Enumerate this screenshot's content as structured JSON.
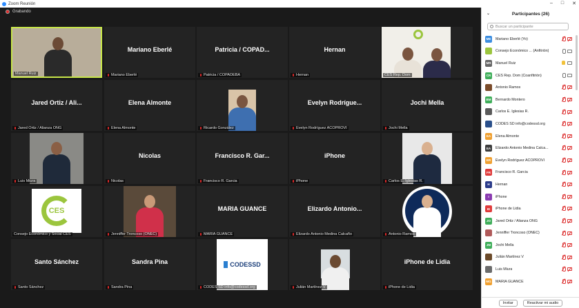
{
  "window": {
    "title": "Zoom Reunión"
  },
  "recording": {
    "label": "Grabando"
  },
  "tiles": [
    {
      "label": "Manuel Ruiz",
      "big": "",
      "muted": false
    },
    {
      "label": "Mariano Eberlé",
      "big": "Mariano Eberlé",
      "muted": true
    },
    {
      "label": "Patricia / COPADEBA",
      "big": "Patricia / COPAD...",
      "muted": true
    },
    {
      "label": "Hernan",
      "big": "Hernan",
      "muted": true
    },
    {
      "label": "CES Rep. Dom",
      "big": "",
      "muted": false
    },
    {
      "label": "Jared Ortiz / Alianza ONG",
      "big": "Jared Ortiz / Ali...",
      "muted": true
    },
    {
      "label": "Elena Almonte",
      "big": "Elena Almonte",
      "muted": true
    },
    {
      "label": "Ricardo González",
      "big": "",
      "muted": true
    },
    {
      "label": "Evelyn Rodríguez ACOPROVI",
      "big": "Evelyn  Rodrígue...",
      "muted": true
    },
    {
      "label": "Jochi Mella",
      "big": "Jochi Mella",
      "muted": true
    },
    {
      "label": "Luis Miura",
      "big": "",
      "muted": true
    },
    {
      "label": "Nicolas",
      "big": "Nicolas",
      "muted": true
    },
    {
      "label": "Francisco  R. Garcia",
      "big": "Francisco  R. Gar...",
      "muted": true
    },
    {
      "label": "iPhone",
      "big": "iPhone",
      "muted": true
    },
    {
      "label": "Carlos E. Iglesias R.",
      "big": "",
      "muted": true
    },
    {
      "label": "Consejo Económico y Social CES",
      "big": "",
      "muted": false
    },
    {
      "label": "Jenniffer Troncoso (ONEC)",
      "big": "",
      "muted": true
    },
    {
      "label": "MARIA GUANCE",
      "big": "MARIA GUANCE",
      "muted": true
    },
    {
      "label": "Elizardo Antonio Medina Calcaño",
      "big": "Elizardo  Antonio...",
      "muted": true
    },
    {
      "label": "Antonio Ramos",
      "big": "",
      "muted": true
    },
    {
      "label": "Santo Sánchez",
      "big": "Santo Sánchez",
      "muted": true
    },
    {
      "label": "Sandra Pina",
      "big": "Sandra Pina",
      "muted": true
    },
    {
      "label": "CODES SD info@codessd.org",
      "big": "",
      "muted": true
    },
    {
      "label": "Julián Martínez V",
      "big": "",
      "muted": true
    },
    {
      "label": "iPhone de Lidia",
      "big": "iPhone de Lidia",
      "muted": true
    }
  ],
  "codes_logo_text": "CODESSD",
  "ces_logo_text": "CES",
  "badge": {
    "name": "Antonio Ramos",
    "subtitle": "Presidente Cámara"
  },
  "panel": {
    "title": "Participantes (26)",
    "search_placeholder": "Buscar un participante",
    "invite_label": "Invitar",
    "unmute_label": "Reactivar mi audio",
    "participants": [
      {
        "initials": "ME",
        "color": "#3b8de0",
        "name": "Mariano Eberlé (Yo)",
        "mic": "off",
        "cam": "off"
      },
      {
        "initials": "",
        "color": "#9bc53d",
        "name": "Consejo Económico ... (Anfitrión)",
        "mic": "on",
        "cam": "on"
      },
      {
        "initials": "MR",
        "color": "#666666",
        "name": "Manuel Ruiz",
        "mic": "hand",
        "cam": "on"
      },
      {
        "initials": "CR",
        "color": "#3fae5a",
        "name": "CES Rep. Dom (Coanfitrión)",
        "mic": "on",
        "cam": "on"
      },
      {
        "initials": "",
        "color": "#7a4b2a",
        "name": "Antonio Ramos",
        "mic": "off",
        "cam": "off"
      },
      {
        "initials": "BM",
        "color": "#3fae5a",
        "name": "Bernardo Montero",
        "mic": "off",
        "cam": "off"
      },
      {
        "initials": "",
        "color": "#5a5a5a",
        "name": "Carlos E. Iglesias R.",
        "mic": "off",
        "cam": "off"
      },
      {
        "initials": "",
        "color": "#2a4f8a",
        "name": "CODES SD info@codessd.org",
        "mic": "off",
        "cam": "off"
      },
      {
        "initials": "EA",
        "color": "#f0a030",
        "name": "Elena Almonte",
        "mic": "off",
        "cam": "off"
      },
      {
        "initials": "EA",
        "color": "#3d3d3d",
        "name": "Elizardo Antonio Medina Calca...",
        "mic": "off",
        "cam": "off"
      },
      {
        "initials": "ER",
        "color": "#f0a030",
        "name": "Evelyn Rodríguez ACOPROVI",
        "mic": "off",
        "cam": "off"
      },
      {
        "initials": "FR",
        "color": "#e03b3b",
        "name": "Francisco  R. Garcia",
        "mic": "off",
        "cam": "off"
      },
      {
        "initials": "H",
        "color": "#2b3b8a",
        "name": "Hernan",
        "mic": "off",
        "cam": "off"
      },
      {
        "initials": "I",
        "color": "#8a3bb0",
        "name": "iPhone",
        "mic": "off",
        "cam": "off"
      },
      {
        "initials": "ID",
        "color": "#e03b3b",
        "name": "iPhone de Lidia",
        "mic": "off",
        "cam": "off"
      },
      {
        "initials": "JO",
        "color": "#3fae5a",
        "name": "Jared Ortiz / Alianza ONG",
        "mic": "off",
        "cam": "off"
      },
      {
        "initials": "",
        "color": "#b05a5a",
        "name": "Jenniffer Troncoso (ONEC)",
        "mic": "off",
        "cam": "off"
      },
      {
        "initials": "JM",
        "color": "#3fae5a",
        "name": "Jochi Mella",
        "mic": "off",
        "cam": "off"
      },
      {
        "initials": "",
        "color": "#6b4a2a",
        "name": "Julián Martínez V",
        "mic": "off",
        "cam": "off"
      },
      {
        "initials": "",
        "color": "#6b6b6b",
        "name": "Luis Miura",
        "mic": "off",
        "cam": "off"
      },
      {
        "initials": "MG",
        "color": "#f0a030",
        "name": "MARIA GUANCE",
        "mic": "off",
        "cam": "off"
      }
    ]
  }
}
